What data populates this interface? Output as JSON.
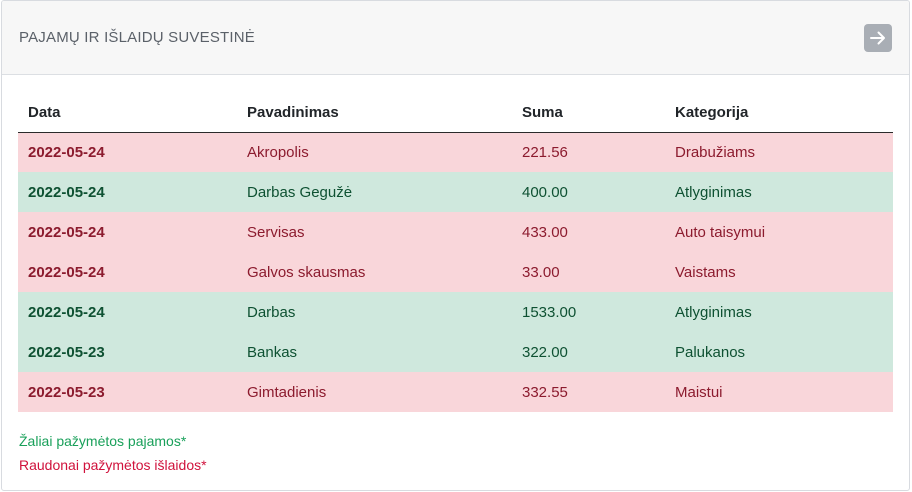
{
  "card": {
    "title": "PAJAMŲ IR IŠLAIDŲ SUVESTINĖ",
    "nav_icon": "arrow-right-icon"
  },
  "table": {
    "headers": [
      "Data",
      "Pavadinimas",
      "Suma",
      "Kategorija"
    ],
    "rows": [
      {
        "type": "expense",
        "date": "2022-05-24",
        "name": "Akropolis",
        "sum": "221.56",
        "category": "Drabužiams"
      },
      {
        "type": "income",
        "date": "2022-05-24",
        "name": "Darbas Gegužė",
        "sum": "400.00",
        "category": "Atlyginimas"
      },
      {
        "type": "expense",
        "date": "2022-05-24",
        "name": "Servisas",
        "sum": "433.00",
        "category": "Auto taisymui"
      },
      {
        "type": "expense",
        "date": "2022-05-24",
        "name": "Galvos skausmas",
        "sum": "33.00",
        "category": "Vaistams"
      },
      {
        "type": "income",
        "date": "2022-05-24",
        "name": "Darbas",
        "sum": "1533.00",
        "category": "Atlyginimas"
      },
      {
        "type": "income",
        "date": "2022-05-23",
        "name": "Bankas",
        "sum": "322.00",
        "category": "Palukanos"
      },
      {
        "type": "expense",
        "date": "2022-05-23",
        "name": "Gimtadienis",
        "sum": "332.55",
        "category": "Maistui"
      }
    ]
  },
  "legend": {
    "income_note": "Žaliai pažymėtos pajamos*",
    "expense_note": "Raudonai pažymėtos išlaidos*"
  },
  "colors": {
    "income_row": "#cfe8dd",
    "income_text": "#0e5132",
    "expense_row": "#f9d6da",
    "expense_text": "#8c1b2e",
    "income_note": "#19a05a",
    "expense_note": "#d0123c"
  }
}
